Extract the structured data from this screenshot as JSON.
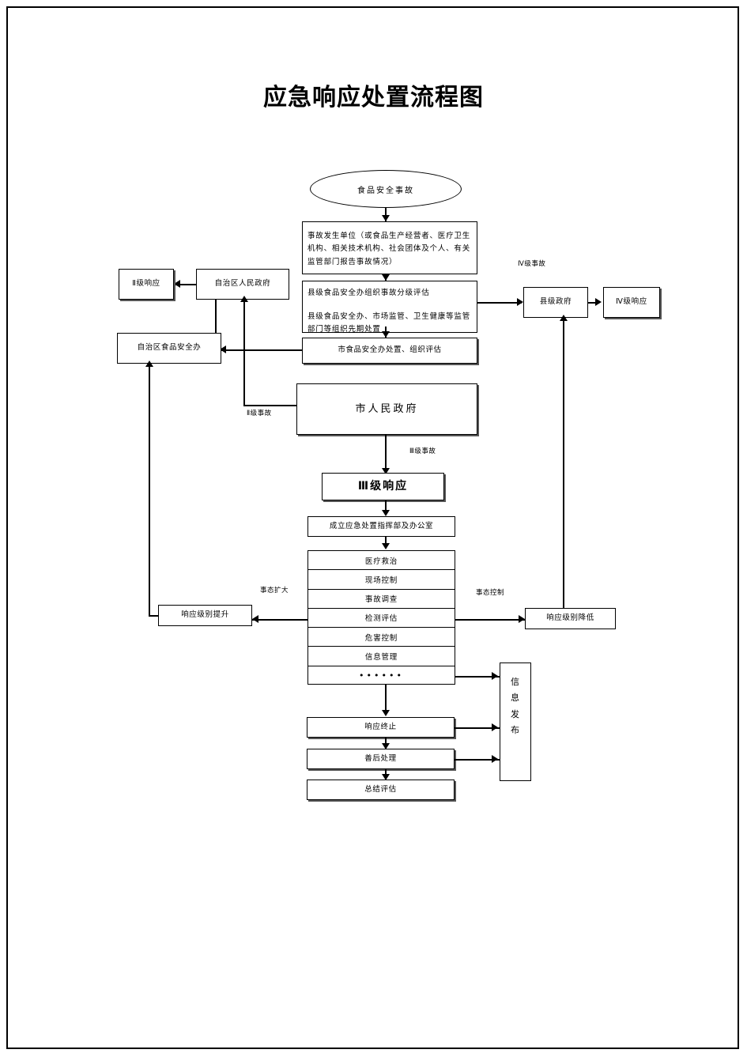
{
  "document": {
    "title": "应急响应处置流程图"
  },
  "nodes": {
    "incident": "食品安全事故",
    "report_unit": "事故发生单位（或食品生产经营者、医疗卫生机构、相关技术机构、社会团体及个人、有关监管部门报告事故情况）",
    "county_grading_line1": "县级食品安全办组织事故分级评估",
    "county_grading_line2": "县级食品安全办、市场监管、卫生健康等监管部门等组织先期处置",
    "city_office_eval": "市食品安全办处置、组织评估",
    "city_government": "市人民政府",
    "level2_response": "Ⅱ级响应",
    "region_government": "自治区人民政府",
    "region_food_office": "自治区食品安全办",
    "county_government": "县级政府",
    "level4_response": "Ⅳ级响应",
    "level3_response": "Ⅲ级响应",
    "setup_command": "成立应急处置指挥部及办公室",
    "response_upgrade": "响应级别提升",
    "response_downgrade": "响应级别降低",
    "info_release": "信息发布",
    "response_end": "响应终止",
    "aftermath": "善后处理",
    "summary_eval": "总结评估"
  },
  "measures": [
    "医疗救治",
    "现场控制",
    "事故调查",
    "检测评估",
    "危害控制",
    "信息管理",
    "••••••"
  ],
  "edge_labels": {
    "level4_incident": "Ⅳ级事故",
    "level2_incident": "Ⅱ级事故",
    "level3_incident": "Ⅲ级事故",
    "situation_expand": "事态扩大",
    "situation_control": "事态控制"
  },
  "colors": {
    "stroke": "#000000",
    "background": "#ffffff",
    "text": "#000000",
    "shadow": "#555555"
  }
}
